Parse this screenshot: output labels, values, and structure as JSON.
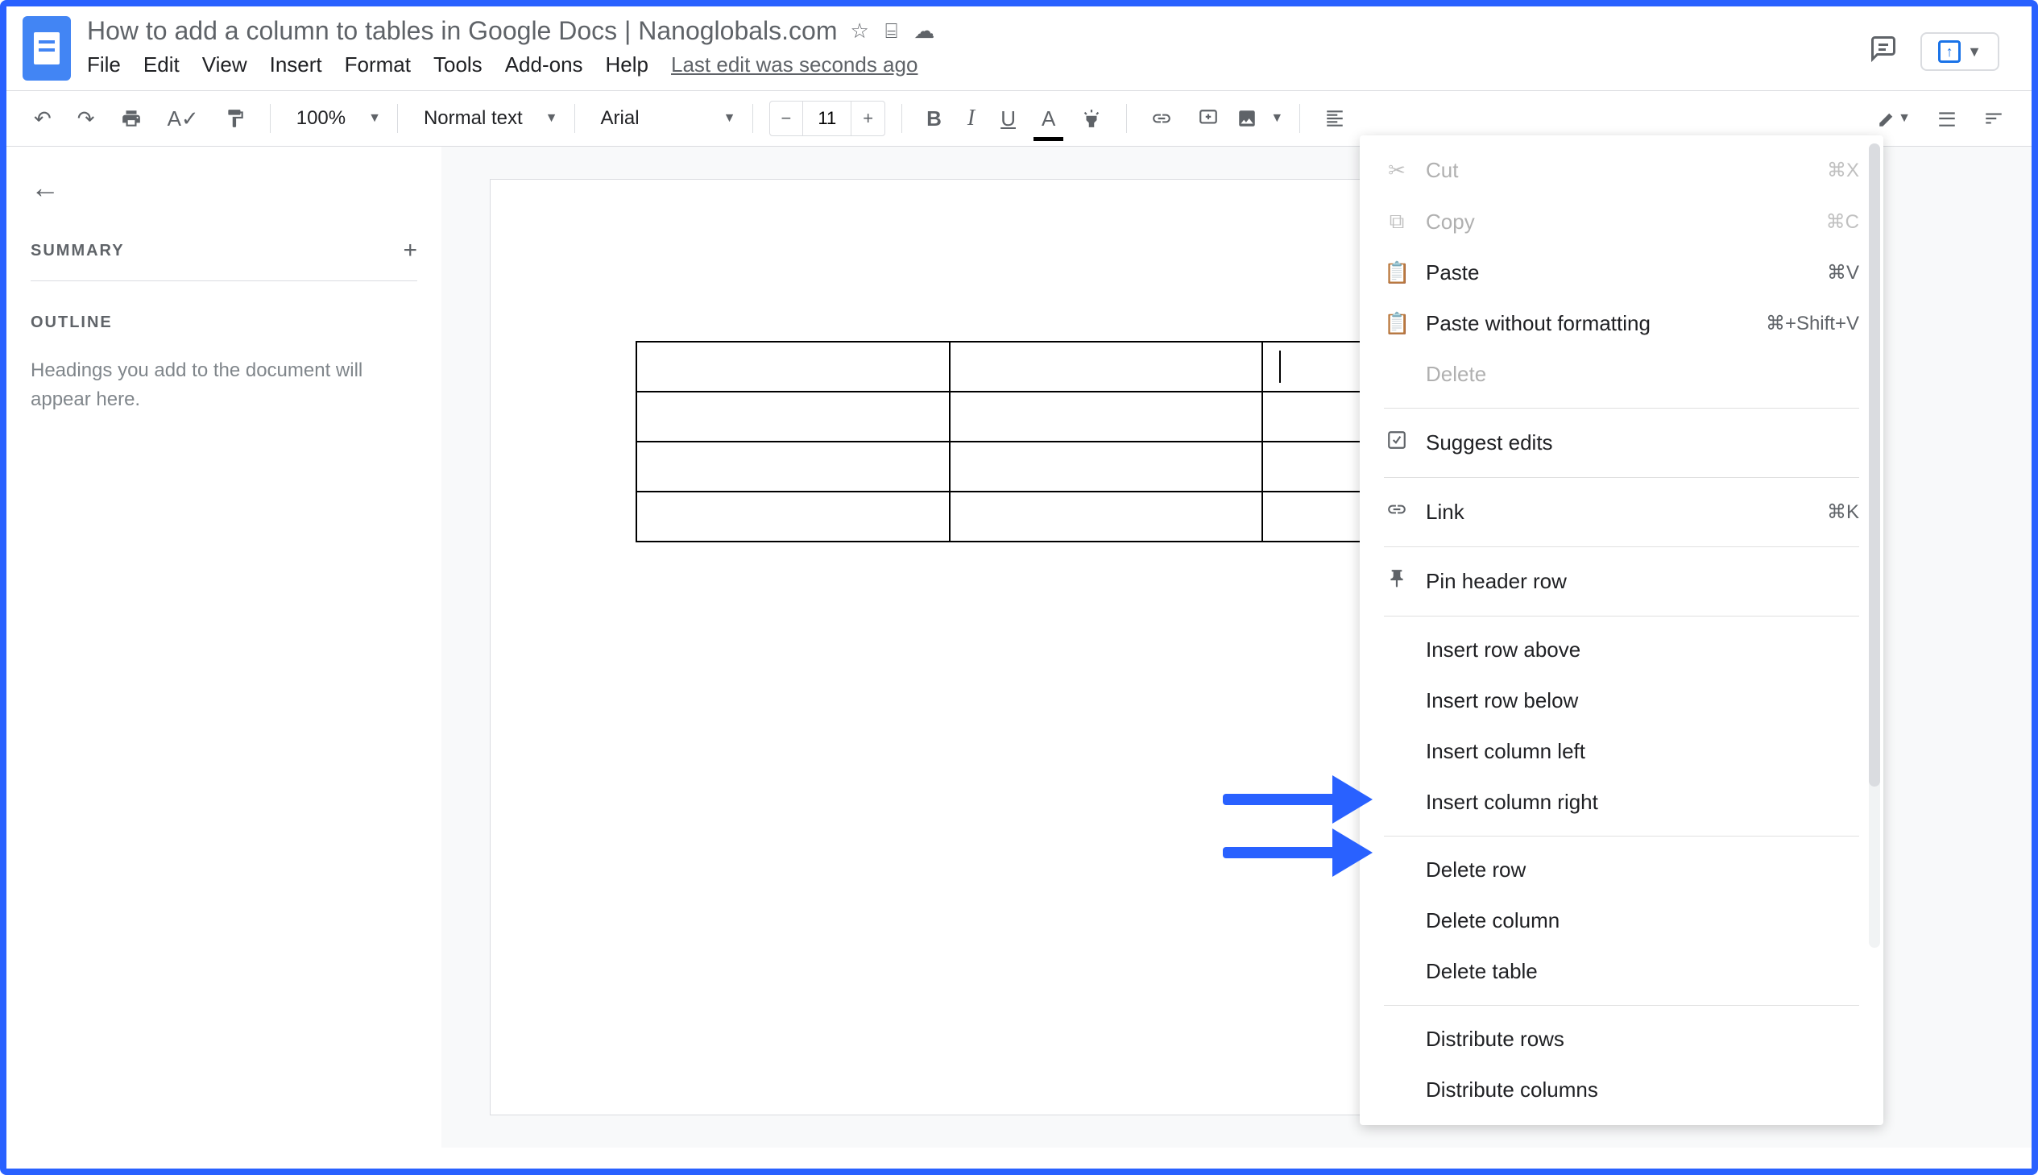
{
  "header": {
    "title": "How to add a column to tables in Google Docs | Nanoglobals.com",
    "menu": [
      "File",
      "Edit",
      "View",
      "Insert",
      "Format",
      "Tools",
      "Add-ons",
      "Help"
    ],
    "last_edit": "Last edit was seconds ago"
  },
  "toolbar": {
    "zoom": "100%",
    "style": "Normal text",
    "font": "Arial",
    "font_size": "11"
  },
  "sidebar": {
    "summary_label": "SUMMARY",
    "outline_label": "OUTLINE",
    "outline_hint": "Headings you add to the document will appear here."
  },
  "context_menu": {
    "cut": {
      "label": "Cut",
      "shortcut": "⌘X"
    },
    "copy": {
      "label": "Copy",
      "shortcut": "⌘C"
    },
    "paste": {
      "label": "Paste",
      "shortcut": "⌘V"
    },
    "paste_nf": {
      "label": "Paste without formatting",
      "shortcut": "⌘+Shift+V"
    },
    "delete": {
      "label": "Delete"
    },
    "suggest": {
      "label": "Suggest edits"
    },
    "link": {
      "label": "Link",
      "shortcut": "⌘K"
    },
    "pin_header": {
      "label": "Pin header row"
    },
    "insert_row_above": {
      "label": "Insert row above"
    },
    "insert_row_below": {
      "label": "Insert row below"
    },
    "insert_col_left": {
      "label": "Insert column left"
    },
    "insert_col_right": {
      "label": "Insert column right"
    },
    "delete_row": {
      "label": "Delete row"
    },
    "delete_col": {
      "label": "Delete column"
    },
    "delete_table": {
      "label": "Delete table"
    },
    "dist_rows": {
      "label": "Distribute rows"
    },
    "dist_cols": {
      "label": "Distribute columns"
    }
  }
}
